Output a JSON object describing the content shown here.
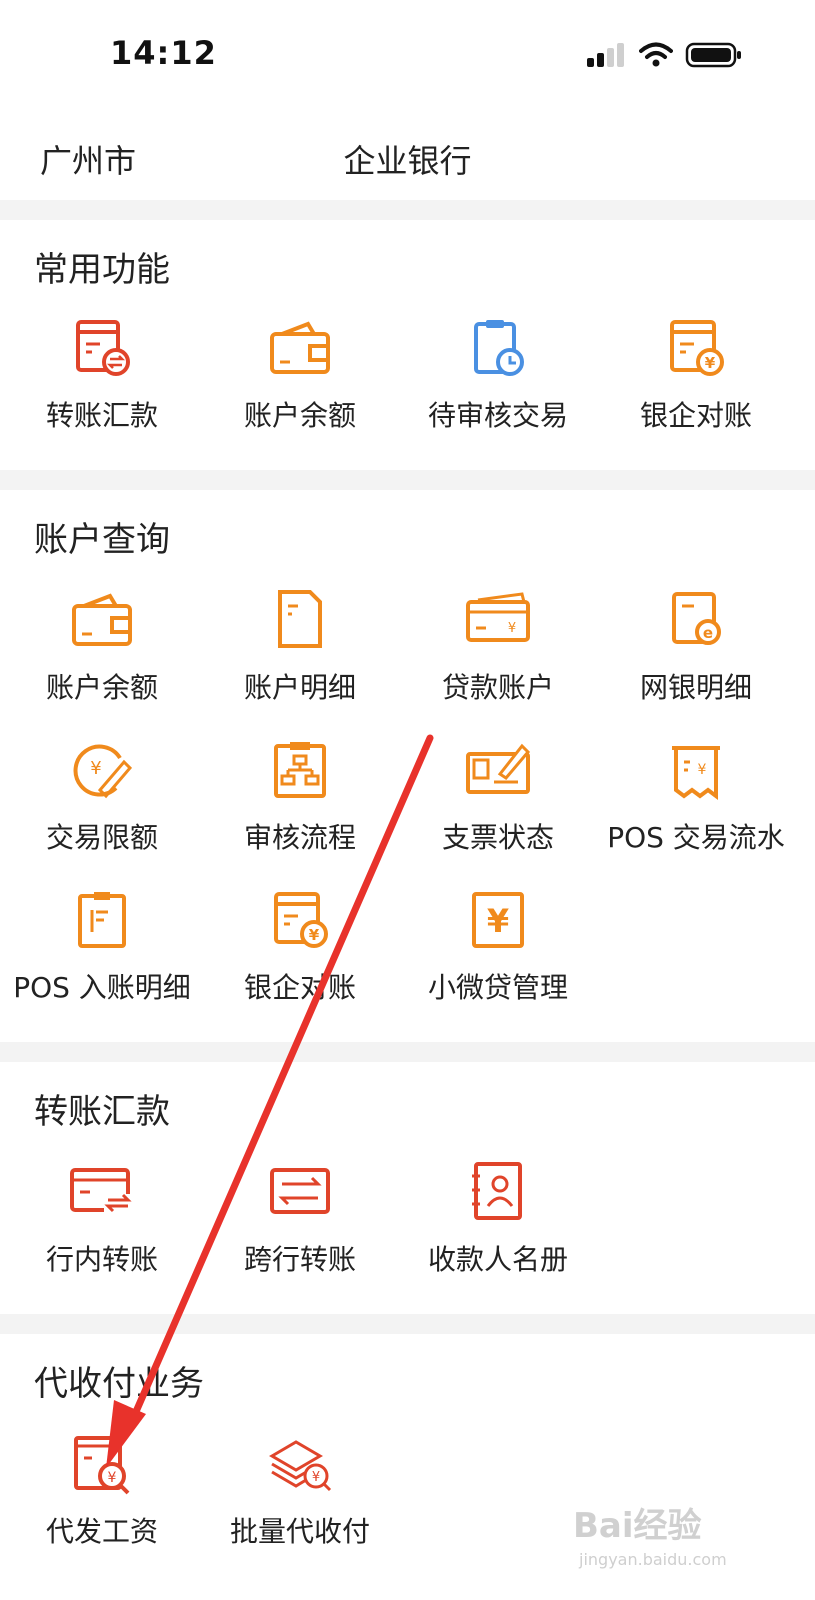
{
  "status_bar": {
    "time": "14:12",
    "signal_icon": "cellular-signal-icon",
    "wifi_icon": "wifi-icon",
    "battery_icon": "battery-icon"
  },
  "header": {
    "city": "广州市",
    "title": "企业银行"
  },
  "colors": {
    "accent": "#f08a1c",
    "red": "#e0442a",
    "blue": "#4a90e2",
    "divider": "#f3f3f3",
    "annotation_arrow": "#e8322b"
  },
  "sections": [
    {
      "title": "常用功能",
      "items": [
        {
          "label": "转账汇款",
          "icon": "transfer-doc-icon"
        },
        {
          "label": "账户余额",
          "icon": "wallet-icon"
        },
        {
          "label": "待审核交易",
          "icon": "clipboard-clock-icon"
        },
        {
          "label": "银企对账",
          "icon": "doc-yen-icon"
        }
      ]
    },
    {
      "title": "账户查询",
      "items": [
        {
          "label": "账户余额",
          "icon": "wallet-icon"
        },
        {
          "label": "账户明细",
          "icon": "document-icon"
        },
        {
          "label": "贷款账户",
          "icon": "card-yen-icon"
        },
        {
          "label": "网银明细",
          "icon": "doc-e-icon"
        },
        {
          "label": "交易限额",
          "icon": "yen-pen-icon"
        },
        {
          "label": "审核流程",
          "icon": "flowchart-icon"
        },
        {
          "label": "支票状态",
          "icon": "cheque-pen-icon"
        },
        {
          "label": "POS 交易流水",
          "icon": "receipt-yen-icon"
        },
        {
          "label": "POS 入账明细",
          "icon": "clipboard-list-icon"
        },
        {
          "label": "银企对账",
          "icon": "doc-yen-icon"
        },
        {
          "label": "小微贷管理",
          "icon": "yen-box-icon"
        }
      ]
    },
    {
      "title": "转账汇款",
      "items": [
        {
          "label": "行内转账",
          "icon": "card-exchange-icon"
        },
        {
          "label": "跨行转账",
          "icon": "card-transfer-icon"
        },
        {
          "label": "收款人名册",
          "icon": "contact-book-icon"
        }
      ]
    },
    {
      "title": "代收付业务",
      "items": [
        {
          "label": "代发工资",
          "icon": "doc-search-yen-icon"
        },
        {
          "label": "批量代收付",
          "icon": "stack-yen-icon"
        }
      ]
    }
  ],
  "watermark": {
    "brand": "Bai经验",
    "url": "jingyan.baidu.com"
  }
}
